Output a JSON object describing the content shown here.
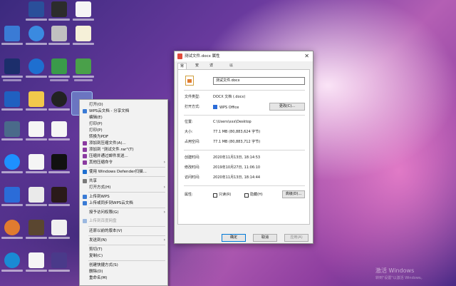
{
  "desktop": {
    "watermark_line1": "激活 Windows",
    "watermark_line2": "转到\"设置\"以激活 Windows。"
  },
  "context_menu": {
    "items": [
      {
        "label": "打开(O)",
        "icon": "open-icon"
      },
      {
        "label": "WPS云文档 - 分享文档",
        "icon": "wps-cloud-icon"
      },
      {
        "label": "编辑(E)",
        "icon": ""
      },
      {
        "label": "打印(P)",
        "icon": ""
      },
      {
        "label": "打印(P)",
        "icon": ""
      },
      {
        "label": "转换为PDF",
        "icon": ""
      },
      {
        "label": "添加到压缩文件(A)...",
        "icon": "archive-icon"
      },
      {
        "label": "添加到 \"测试文件.rar\"(T)",
        "icon": "archive-icon"
      },
      {
        "label": "压缩并通过邮件发送...",
        "icon": "archive-icon"
      },
      {
        "label": "其他压缩命令",
        "icon": "archive-icon"
      },
      {
        "label": "使用 Windows Defender扫描...",
        "icon": "defender-icon"
      },
      {
        "label": "共享",
        "icon": "share-icon"
      },
      {
        "label": "打开方式(H)",
        "icon": ""
      },
      {
        "label": "上传到WPS",
        "icon": "upload-icon"
      },
      {
        "label": "上传或同步到WPS云文档",
        "icon": "wps-cloud-icon"
      },
      {
        "label": "授予访问权限(G)",
        "icon": ""
      },
      {
        "label": "上传到百度网盘",
        "icon": "baidu-icon"
      },
      {
        "label": "还原以前的版本(V)",
        "icon": ""
      },
      {
        "label": "发送到(N)",
        "icon": ""
      },
      {
        "label": "剪切(T)",
        "icon": ""
      },
      {
        "label": "复制(C)",
        "icon": ""
      },
      {
        "label": "创建快捷方式(S)",
        "icon": ""
      },
      {
        "label": "删除(D)",
        "icon": ""
      },
      {
        "label": "重命名(M)",
        "icon": ""
      }
    ]
  },
  "dialog": {
    "title": "测试文件.docx 属性",
    "close_glyph": "✕",
    "tabs": [
      "常规",
      "安全",
      "详细信息",
      "以前的版本"
    ],
    "file_name": "测试文件.docx",
    "fields": {
      "type_label": "文件类型:",
      "type_value": "DOCX 文档 (.docx)",
      "opens_label": "打开方式:",
      "opens_value": "WPS Office",
      "change_button": "更改(C)...",
      "location_label": "位置:",
      "location_value": "C:\\Users\\xxx\\Desktop",
      "size_label": "大小:",
      "size_value": "77.1 MB (80,883,624 字节)",
      "disk_label": "占用空间:",
      "disk_value": "77.1 MB (80,883,712 字节)",
      "created_label": "创建时间:",
      "created_value": "2020年11月13日, 18:14:53",
      "modified_label": "修改时间:",
      "modified_value": "2019年10月27日, 11:06:10",
      "accessed_label": "访问时间:",
      "accessed_value": "2020年11月13日, 18:14:44",
      "attrs_label": "属性:",
      "readonly_label": "只读(R)",
      "hidden_label": "隐藏(H)",
      "advanced_button": "高级(D)..."
    },
    "buttons": {
      "ok": "确定",
      "cancel": "取消",
      "apply": "应用(A)"
    }
  }
}
